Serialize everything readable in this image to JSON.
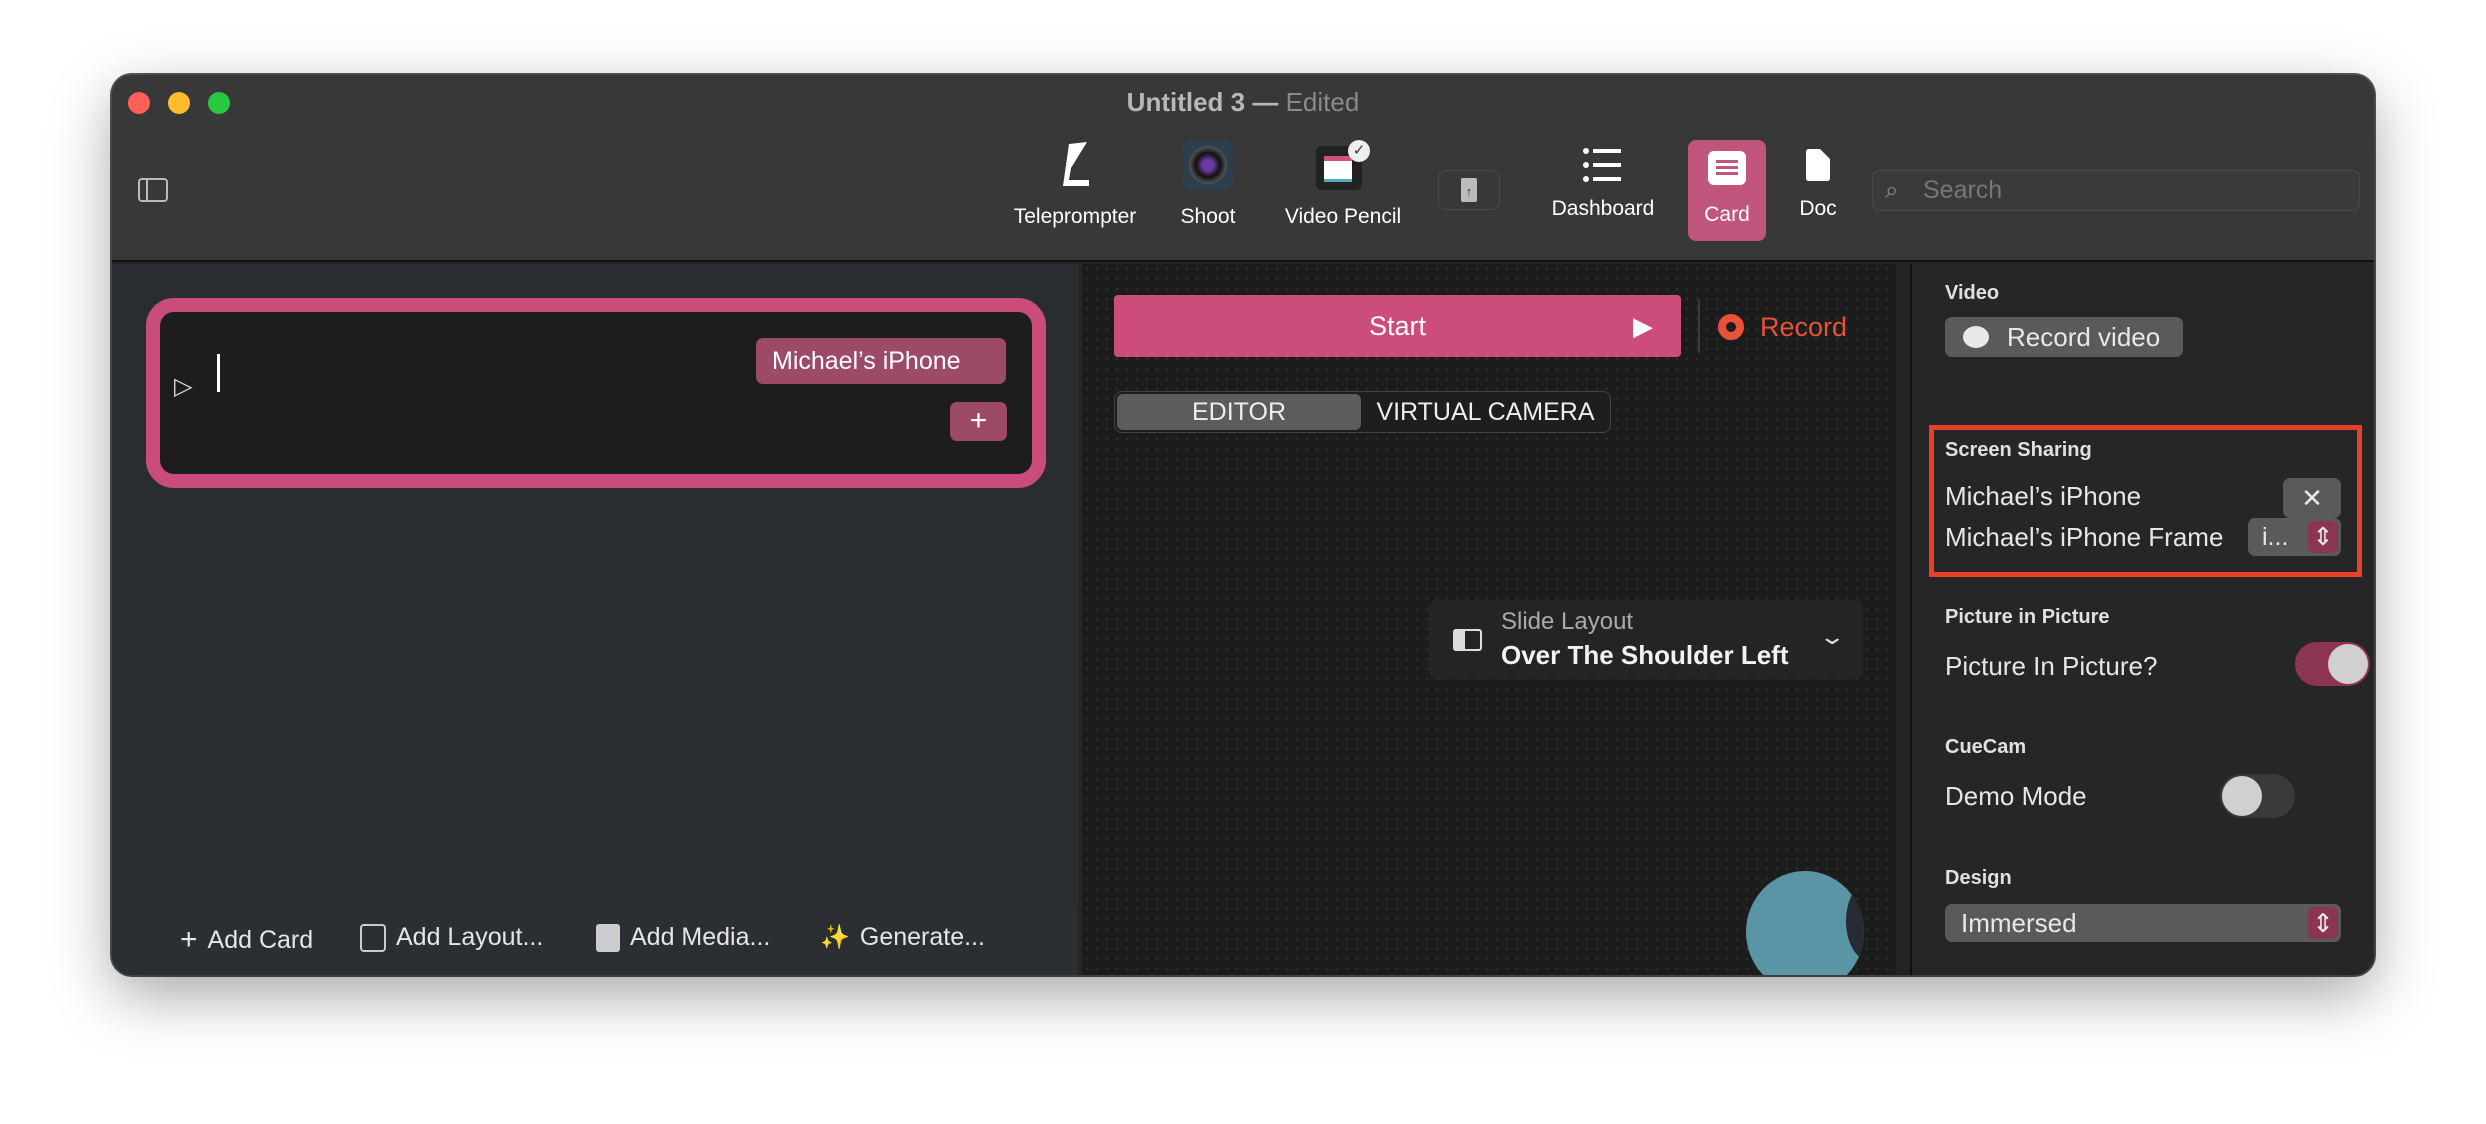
{
  "window": {
    "title": "Untitled 3",
    "title_sep": "—",
    "edited": "Edited"
  },
  "toolbar": {
    "items": [
      {
        "label": "Teleprompter",
        "icon": "teleprompter-icon"
      },
      {
        "label": "Shoot",
        "icon": "camera-lens-icon"
      },
      {
        "label": "Video Pencil",
        "icon": "video-pencil-icon"
      },
      {
        "label": "",
        "icon": "share-document-icon"
      },
      {
        "label": "Dashboard",
        "icon": "list-icon"
      },
      {
        "label": "Card",
        "icon": "card-icon",
        "selected": true
      },
      {
        "label": "Doc",
        "icon": "document-icon"
      }
    ],
    "search_placeholder": "Search"
  },
  "card": {
    "chip": "Michael’s iPhone",
    "add": "+"
  },
  "bottom": {
    "add_card": "Add Card",
    "add_layout": "Add Layout...",
    "add_media": "Add Media...",
    "generate": "Generate..."
  },
  "center": {
    "start": "Start",
    "record": "Record",
    "tabs": [
      "EDITOR",
      "VIRTUAL CAMERA"
    ],
    "active_tab": "EDITOR",
    "slide_layout_label": "Slide Layout",
    "slide_layout_value": "Over The Shoulder Left"
  },
  "inspector": {
    "video": {
      "header": "Video",
      "record_video": "Record video"
    },
    "screen_sharing": {
      "header": "Screen Sharing",
      "device": "Michael’s iPhone",
      "frame_label": "Michael’s iPhone Frame",
      "frame_value": "i..."
    },
    "pip": {
      "header": "Picture in Picture",
      "label": "Picture In Picture?",
      "on": true
    },
    "cuecam": {
      "header": "CueCam",
      "label": "Demo Mode",
      "on": false
    },
    "design": {
      "header": "Design",
      "value": "Immersed"
    }
  },
  "colors": {
    "accent": "#c94c7a",
    "chip": "#9c4a68",
    "record": "#e8513a",
    "highlight_box": "#e8412b"
  }
}
